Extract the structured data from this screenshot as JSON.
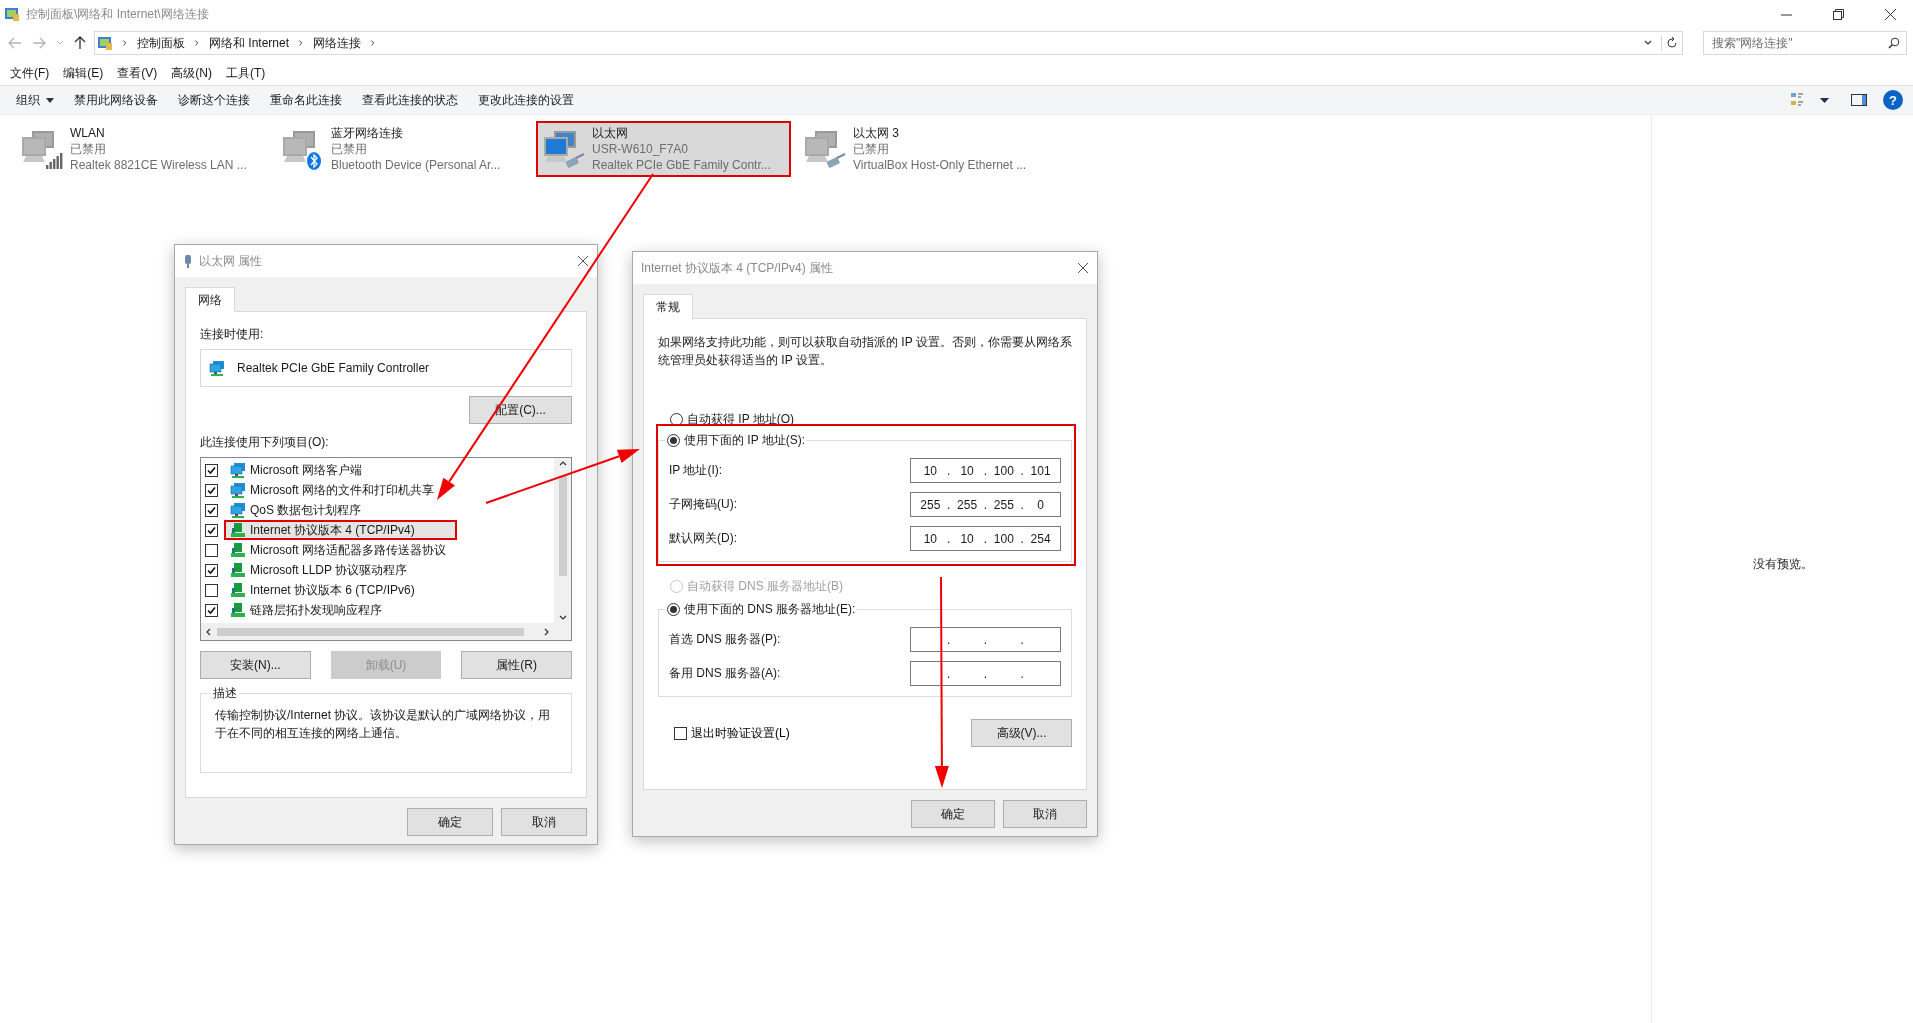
{
  "window": {
    "title": "控制面板\\网络和 Internet\\网络连接"
  },
  "address_bar": {
    "breadcrumbs": [
      "控制面板",
      "网络和 Internet",
      "网络连接"
    ]
  },
  "search": {
    "placeholder": "搜索\"网络连接\""
  },
  "menu": [
    "文件(F)",
    "编辑(E)",
    "查看(V)",
    "高级(N)",
    "工具(T)"
  ],
  "toolbar": {
    "items": [
      "组织",
      "禁用此网络设备",
      "诊断这个连接",
      "重命名此连接",
      "查看此连接的状态",
      "更改此连接的设置"
    ],
    "help": "?"
  },
  "connections": [
    {
      "name": "WLAN",
      "status": "已禁用",
      "device": "Realtek 8821CE Wireless LAN ...",
      "kind": "wireless",
      "disabled": true,
      "selected": false,
      "highlighted": false
    },
    {
      "name": "蓝牙网络连接",
      "status": "已禁用",
      "device": "Bluetooth Device (Personal Ar...",
      "kind": "bluetooth",
      "disabled": true,
      "selected": false,
      "highlighted": false
    },
    {
      "name": "以太网",
      "status": "USR-W610_F7A0",
      "device": "Realtek PCIe GbE Family Contr...",
      "kind": "ethernet",
      "disabled": false,
      "selected": true,
      "highlighted": true
    },
    {
      "name": "以太网 3",
      "status": "已禁用",
      "device": "VirtualBox Host-Only Ethernet ...",
      "kind": "ethernet",
      "disabled": true,
      "selected": false,
      "highlighted": false
    }
  ],
  "preview": {
    "text": "没有预览。"
  },
  "ethernet_properties": {
    "title": "以太网 属性",
    "tabs": [
      {
        "label": "网络",
        "selected": true
      }
    ],
    "connect_using_label": "连接时使用:",
    "adapter": "Realtek PCIe GbE Family Controller",
    "configure_button": "配置(C)...",
    "items_label": "此连接使用下列项目(O):",
    "items": [
      {
        "label": "Microsoft 网络客户端",
        "kind": "service",
        "checked": true,
        "selected": false,
        "highlighted": false
      },
      {
        "label": "Microsoft 网络的文件和打印机共享",
        "kind": "service",
        "checked": true,
        "selected": false,
        "highlighted": false
      },
      {
        "label": "QoS 数据包计划程序",
        "kind": "service",
        "checked": true,
        "selected": false,
        "highlighted": false
      },
      {
        "label": "Internet 协议版本 4 (TCP/IPv4)",
        "kind": "protocol",
        "checked": true,
        "selected": true,
        "highlighted": true
      },
      {
        "label": "Microsoft 网络适配器多路传送器协议",
        "kind": "protocol",
        "checked": false,
        "selected": false,
        "highlighted": false
      },
      {
        "label": "Microsoft LLDP 协议驱动程序",
        "kind": "protocol",
        "checked": true,
        "selected": false,
        "highlighted": false
      },
      {
        "label": "Internet 协议版本 6 (TCP/IPv6)",
        "kind": "protocol",
        "checked": false,
        "selected": false,
        "highlighted": false
      },
      {
        "label": "链路层拓扑发现响应程序",
        "kind": "protocol",
        "checked": true,
        "selected": false,
        "highlighted": false
      }
    ],
    "item_buttons": [
      {
        "label": "安装(N)...",
        "disabled": false
      },
      {
        "label": "卸载(U)",
        "disabled": true
      },
      {
        "label": "属性(R)",
        "disabled": false
      }
    ],
    "description": {
      "legend": "描述",
      "text": "传输控制协议/Internet 协议。该协议是默认的广域网络协议，用于在不同的相互连接的网络上通信。"
    },
    "footer_buttons": [
      "确定",
      "取消"
    ]
  },
  "ipv4_properties": {
    "title": "Internet 协议版本 4 (TCP/IPv4) 属性",
    "tabs": [
      {
        "label": "常规",
        "selected": true
      }
    ],
    "intro": "如果网络支持此功能，则可以获取自动指派的 IP 设置。否则，你需要从网络系统管理员处获得适当的 IP 设置。",
    "ip_auto": {
      "label": "自动获得 IP 地址(O)",
      "selected": false,
      "disabled": false
    },
    "ip_manual": {
      "label": "使用下面的 IP 地址(S):",
      "selected": true,
      "highlighted": true,
      "fields": [
        {
          "label": "IP 地址(I):",
          "octets": [
            "10",
            "10",
            "100",
            "101"
          ],
          "separator": "."
        },
        {
          "label": "子网掩码(U):",
          "octets": [
            "255",
            "255",
            "255",
            "0"
          ],
          "separator": "."
        },
        {
          "label": "默认网关(D):",
          "octets": [
            "10",
            "10",
            "100",
            "254"
          ],
          "separator": "."
        }
      ]
    },
    "dns_auto": {
      "label": "自动获得 DNS 服务器地址(B)",
      "selected": false,
      "disabled": true
    },
    "dns_manual": {
      "label": "使用下面的 DNS 服务器地址(E):",
      "selected": true,
      "fields": [
        {
          "label": "首选 DNS 服务器(P):",
          "separator": "."
        },
        {
          "label": "备用 DNS 服务器(A):",
          "separator": "."
        }
      ]
    },
    "validate": {
      "label": "退出时验证设置(L)",
      "checked": false
    },
    "advanced_button": "高级(V)...",
    "footer_buttons": [
      "确定",
      "取消"
    ]
  }
}
